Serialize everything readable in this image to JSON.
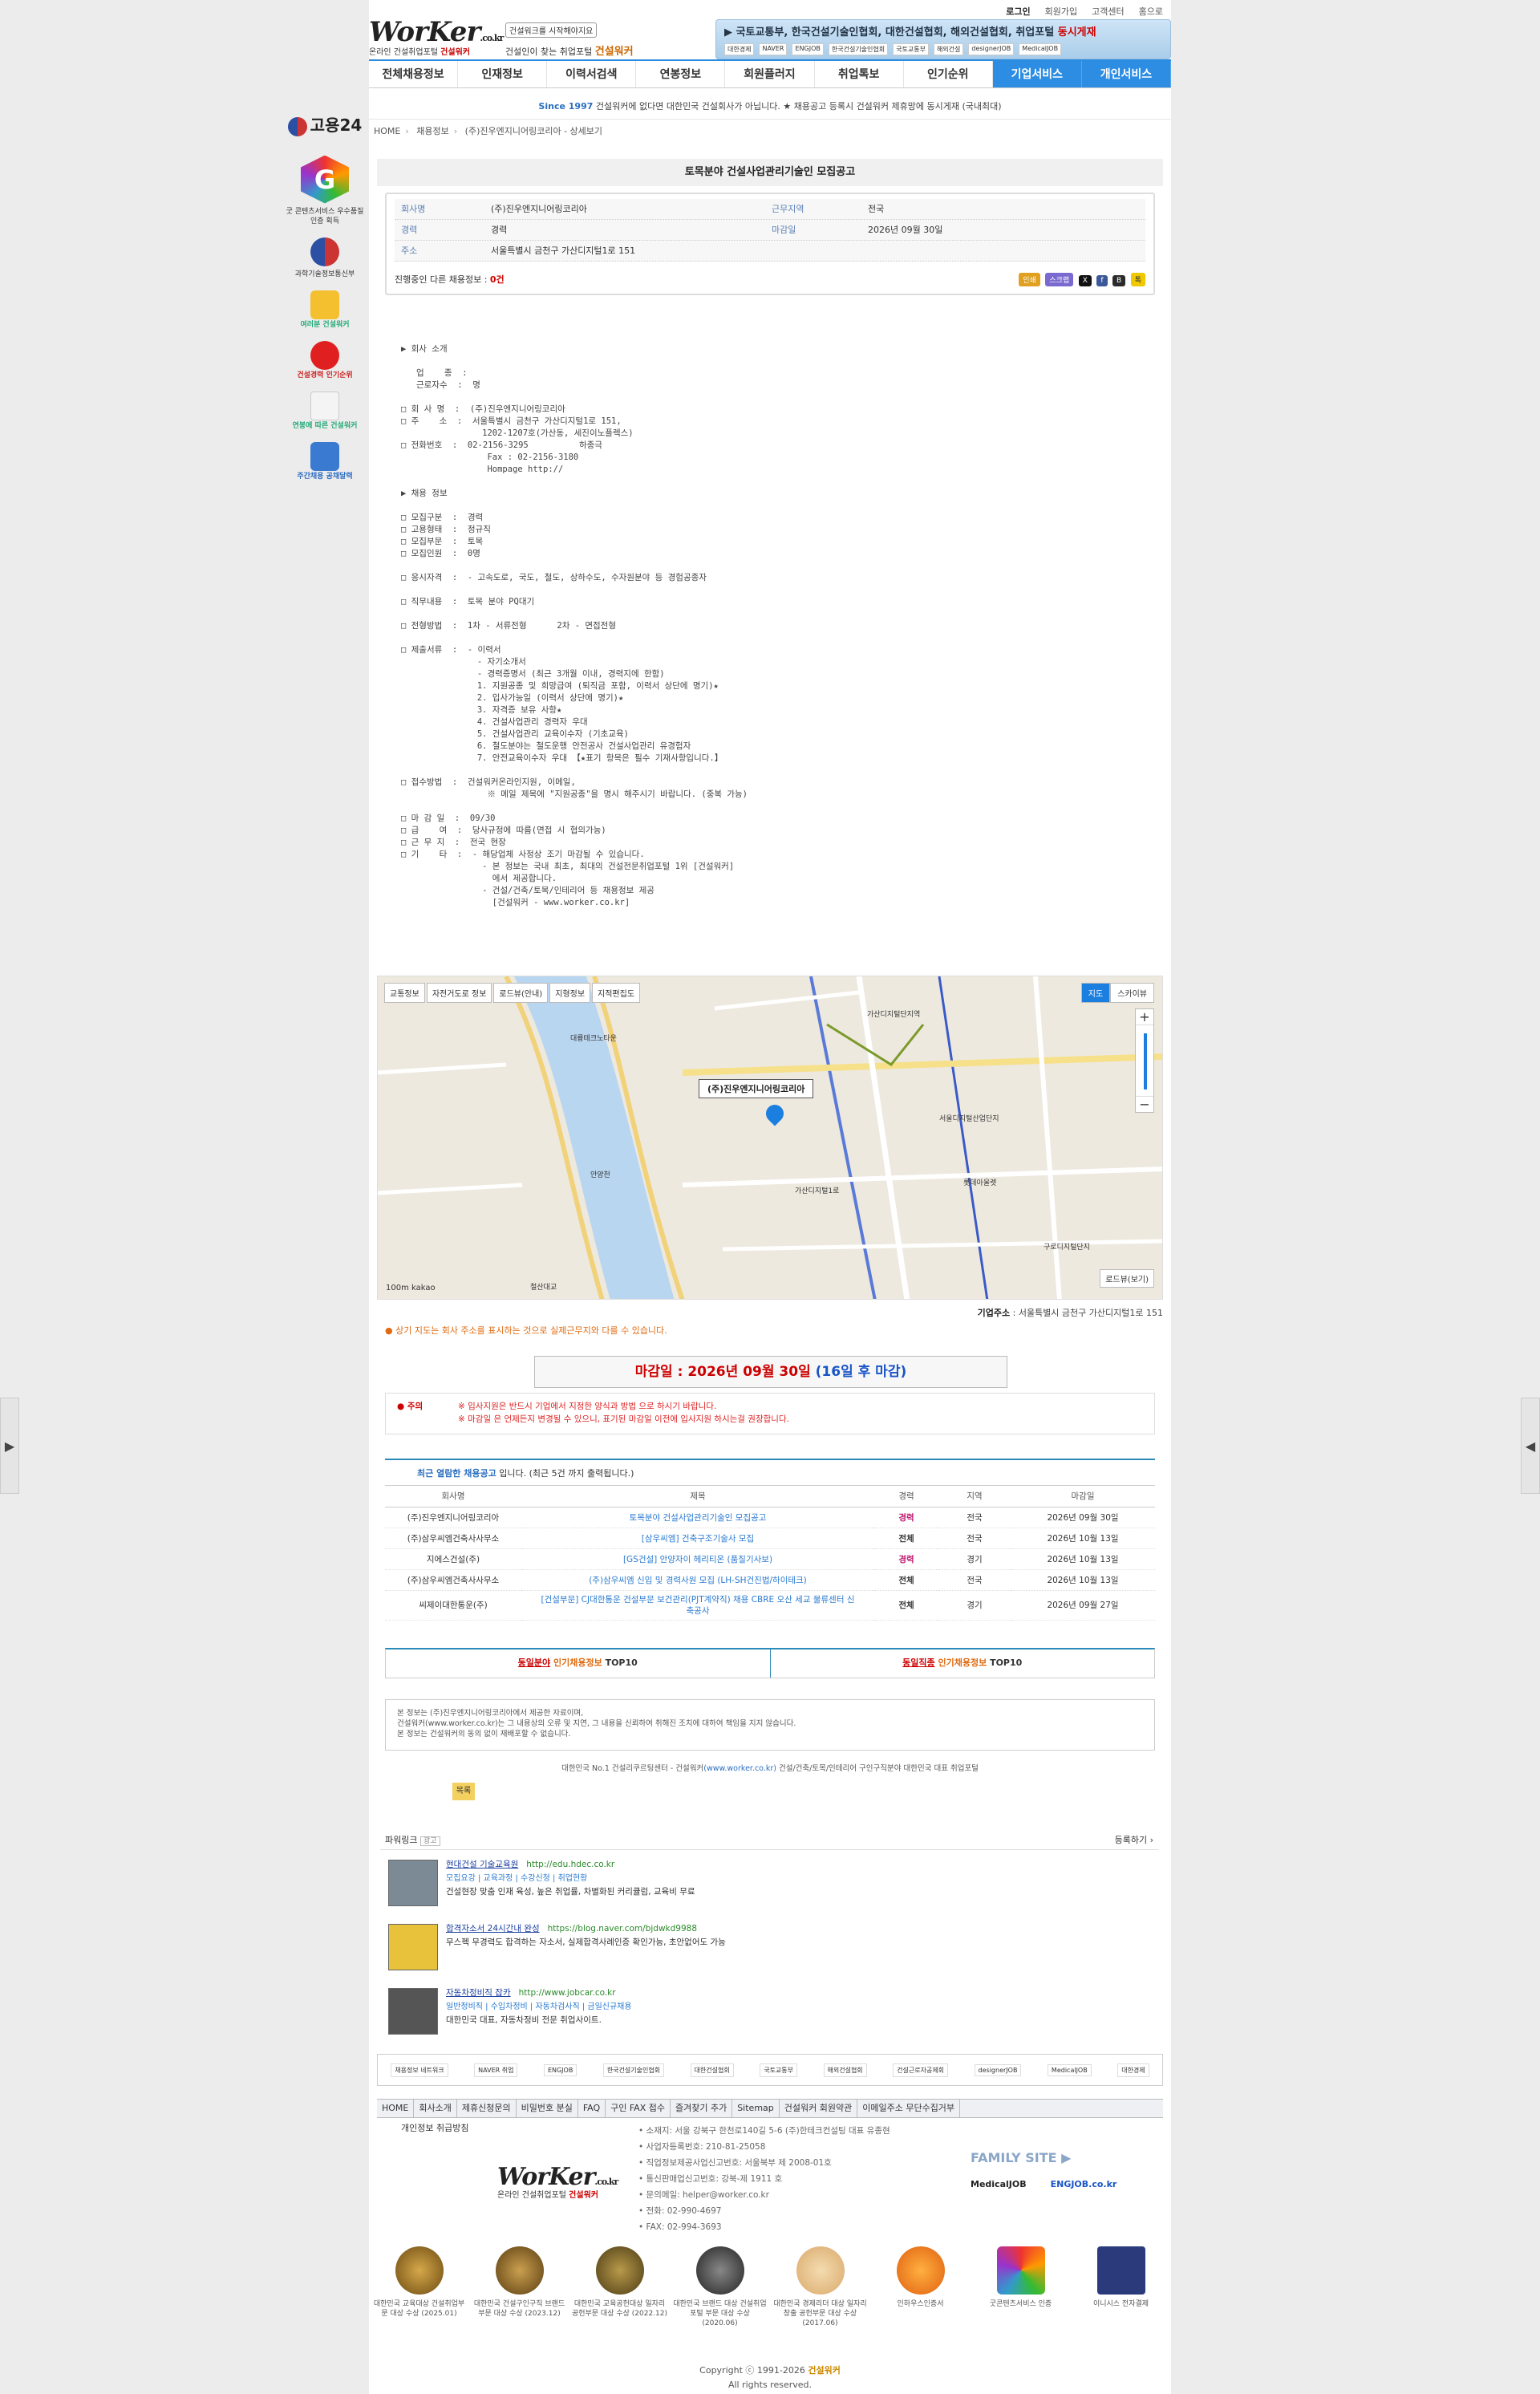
{
  "util": {
    "login": "로그인",
    "join": "회원가입",
    "cs": "고객센터",
    "home": "홈으로"
  },
  "logo": {
    "main": "WorKer",
    "tld": ".co.kr",
    "tagline_prefix": "온라인 건설취업포털",
    "tagline_brand": "건설워커"
  },
  "promo": {
    "pill": "건설워크를 시작해야지요",
    "line_prefix": "건설인이 찾는 취업포털",
    "line_brand": "건설워커"
  },
  "banner": {
    "text": "국토교통부, 한국건설기술인협회, 대한건설협회, 해외건설협회, 취업포털",
    "em": "동시게재",
    "logos": [
      "대한경제",
      "NAVER",
      "ENGJOB",
      "한국건설기술인협회",
      "국토교통부",
      "해외건설",
      "designerJOB",
      "MedicalJOB"
    ]
  },
  "nav": [
    "전체채용정보",
    "인재정보",
    "이력서검색",
    "연봉정보",
    "회원플러지",
    "취업톡보",
    "인기순위",
    "기업서비스",
    "개인서비스"
  ],
  "notice": {
    "since": "Since 1997",
    "text": "건설워커에 없다면 대한민국 건설회사가 아닙니다. ★ 채용공고 등록시 건설워커 제휴망에 동시게재 (국내최대)"
  },
  "side": {
    "goyong": "고용24",
    "cert": "굿 콘텐츠서비스 우수품질인증 획득",
    "ministry": "과학기술정보통신부",
    "items": [
      "여러분 건설워커",
      "건설경력 인기순위",
      "연봉에 따른 건설워커",
      "주간채용 공채달력"
    ]
  },
  "breadcrumb": [
    "HOME",
    "채용정보",
    "(주)진우엔지니어링코리아 - 상세보기"
  ],
  "job": {
    "title": "토목분야 건설사업관리기술인 모집공고",
    "rows": [
      {
        "k": "회사명",
        "v": "(주)진우엔지니어링코리아",
        "k2": "근무지역",
        "v2": "전국"
      },
      {
        "k": "경력",
        "v": "경력",
        "k2": "마감일",
        "v2": "2026년 09월 30일"
      },
      {
        "k": "주소",
        "v": "서울특별시 금천구 가산디지털1로 151",
        "k2": "",
        "v2": ""
      }
    ],
    "ongoing_label": "진행중인 다른 채용정보 :",
    "ongoing_count": "0건",
    "btns": [
      "인쇄",
      "스크랩",
      "X",
      "f",
      "B",
      "톡"
    ]
  },
  "content": "▶ 회사 소개\n\n   업    종  :\n   근로자수  :  명\n\n□ 회 사 명  :  (주)진우엔지니어링코리아\n□ 주    소  :  서울특별시 금천구 가산디지털1로 151,\n                1202-1207호(가산동, 세진이노플렉스)\n□ 전화번호  :  02-2156-3295          하종극\n                 Fax : 02-2156-3180\n                 Hompage http://\n\n▶ 채용 정보\n\n□ 모집구분  :  경력\n□ 고용형태  :  정규직\n□ 모집부문  :  토목\n□ 모집인원  :  0명\n\n□ 응시자격  :  - 고속도로, 국도, 철도, 상하수도, 수자원분야 등 경험공종자\n\n□ 직무내용  :  토목 분야 PQ대기\n\n□ 전형방법  :  1차 - 서류전형      2차 - 면접전형\n\n□ 제출서류  :  - 이력서\n               - 자기소개서\n               - 경력증명서 (최근 3개월 이내, 경력지에 한함)\n               1. 지원공종 및 희망급여 (퇴직금 포함, 이력서 상단에 명기)★\n               2. 입사가능일 (이력서 상단에 명기)★\n               3. 자격증 보유 사항★\n               4. 건설사업관리 경력자 우대\n               5. 건설사업관리 교육이수자 (기초교육)\n               6. 철도분야는 철도운행 안전공사 건설사업관리 유경험자\n               7. 안전교육이수자 우대 【★표기 항목은 필수 기재사항입니다.】\n\n□ 접수방법  :  건설워커온라인지원, 이메일,\n                 ※ 메일 제목에 \"지원공종\"을 명시 해주시기 바랍니다. (중복 가능)\n\n□ 마 감 일  :  09/30\n□ 급    여  :  당사규정에 따름(면접 시 협의가능)\n□ 근 무 지  :  전국 현장\n□ 기    타  :  - 해당업체 사정상 조기 마감될 수 있습니다.\n                - 본 정보는 국내 최초, 최대의 건설전문취업포털 1위 [건설워커]\n                  에서 제공합니다.\n                - 건설/건축/토목/인테리어 등 채용정보 제공\n                  [건설워커 - www.worker.co.kr]",
  "map": {
    "toolbar": [
      "교통정보",
      "자전거도로 정보",
      "로드뷰(안내)",
      "지형정보",
      "지적편집도"
    ],
    "types": [
      "지도",
      "스카이뷰"
    ],
    "label": "(주)진우엔지니어링코리아",
    "roadview": "로드뷰(보기)",
    "scale": "100m  kakao",
    "pois": [
      "가산디지털단지역",
      "서울디지털산업단지",
      "롯데아울렛",
      "대륭테크노타운",
      "가산디지털1로",
      "안양천",
      "철산대교",
      "구로디지털단지"
    ]
  },
  "addr": {
    "label": "기업주소",
    "value": "서울특별시 금천구 가산디지털1로 151"
  },
  "mapnote": "상기 지도는 회사 주소를 표시하는 것으로 실제근무지와 다를 수 있습니다.",
  "deadline": {
    "prefix": "마감일 : 2026년 09월 30일",
    "remain": "(16일 후 마감)"
  },
  "warn": {
    "title": "주의",
    "l1": "※ 입사지원은 반드시 기업에서 지정한 양식과 방법 으로 하시기 바랍니다.",
    "l2": "※ 마감일 은 언제든지 변경될 수 있으니, 표기된 마감일 이전에 입사지원 하시는걸 권장합니다."
  },
  "recent": {
    "hd_em": "최근 열람한 채용공고",
    "hd_text": "입니다.   (최근 5건 까지 출력됩니다.)",
    "cols": [
      "회사명",
      "제목",
      "경력",
      "지역",
      "마감일"
    ],
    "rows": [
      [
        "(주)진우엔지니어링코리아",
        "토목분야 건설사업관리기술인 모집공고",
        "경력",
        "전국",
        "2026년 09월 30일"
      ],
      [
        "(주)삼우씨엠건축사사무소",
        "[삼우씨엠] 건축구조기술사 모집",
        "전체",
        "전국",
        "2026년 10월 13일"
      ],
      [
        "지에스건설(주)",
        "[GS건설] 안양자이 헤리티온 (품질기사보)",
        "경력",
        "경기",
        "2026년 10월 13일"
      ],
      [
        "(주)삼우씨엠건축사사무소",
        "(주)삼우씨엠 신입 및 경력사원 모집 (LH-SH건진법/하이테크)",
        "전체",
        "전국",
        "2026년 10월 13일"
      ],
      [
        "씨제이대한통운(주)",
        "[건설부문] CJ대한통운 건설부문 보건관리(PJT계약직) 채용 CBRE 오산 세교 물류센터 신축공사",
        "전체",
        "경기",
        "2026년 09월 27일"
      ]
    ]
  },
  "tops": {
    "left_u": "동일분야",
    "left_em": "인기채용정보",
    "left_t": "TOP10",
    "right_u": "동일직종",
    "right_em": "인기채용정보",
    "right_t": "TOP10"
  },
  "disclaimer": [
    "본 정보는 (주)진우엔지니어링코리아에서 제공한 자료이며,",
    "건설워커(www.worker.co.kr)는 그 내용상의 오류 및 지연, 그 내용을 신뢰하여 취해진 조치에 대하여 책임을 지지 않습니다.",
    "본 정보는 건설워커의 동의 없이 재배포할 수 없습니다."
  ],
  "copyline": {
    "prefix": "대한민국 No.1 건설리쿠르팅센터 - 건설워커",
    "url": "(www.worker.co.kr)",
    "suffix": "건설/건축/토목/인테리어 구인구직분야 대한민국 대표 취업포털"
  },
  "smallbtn": "목록",
  "power": {
    "title": "파워링크",
    "ad": "광고",
    "register": "등록하기 ›",
    "items": [
      {
        "name": "현대건설 기술교육원",
        "url": "http://edu.hdec.co.kr",
        "sub": "모집요강 | 교육과정 | 수강신청 | 취업현황",
        "desc": "건설현장 맞춤 인재 육성, 높은 취업률, 차별화된 커리큘럼, 교육비 무료"
      },
      {
        "name": "합격자소서 24시간내 완성",
        "url": "https://blog.naver.com/bjdwkd9988",
        "sub": "",
        "desc": "무스펙 무경력도 합격하는 자소서, 실제합격사례인증 확인가능, 초안없어도 가능"
      },
      {
        "name": "자동차정비직 잡카",
        "url": "http://www.jobcar.co.kr",
        "sub": "일반정비직 | 수입차정비 | 자동차검사직 | 금일신규채용",
        "desc": "대한민국 대표, 자동차정비 전문 취업사이트."
      }
    ]
  },
  "partners": [
    "채용정보 네트워크",
    "NAVER 취업",
    "ENGJOB",
    "한국건설기술인협회",
    "대한건설협회",
    "국토교통부",
    "해외건설협회",
    "건설근로자공제회",
    "designerJOB",
    "MedicalJOB",
    "대한경제"
  ],
  "fnav": [
    "HOME",
    "회사소개",
    "제휴신청문의",
    "비밀번호 분실",
    "FAQ",
    "구인 FAX 접수",
    "즐겨찾기 추가",
    "Sitemap",
    "건설워커 회원약관",
    "이메일주소 무단수집거부"
  ],
  "privacy": "개인정보 취급방침",
  "finfo": [
    "소재지: 서울 강북구 한천로140길 5-6 (주)한테크컨설팅 대표 유종현",
    "사업자등록번호: 210-81-25058",
    "직업정보제공사업신고번호: 서울북부 제 2008-01호",
    "통신판매업신고번호: 강북-제 1911 호",
    "문의메일: helper@worker.co.kr",
    "전화: 02-990-4697",
    "FAX: 02-994-3693"
  ],
  "family": "FAMILY SITE ▶",
  "family_sites": [
    "MedicalJOB",
    "ENGJOB.co.kr"
  ],
  "awards": [
    {
      "t": "대한민국 교육대상 건설취업부문 대상 수상 (2025.01)",
      "c": "#6b4a12"
    },
    {
      "t": "대한민국 건설구인구직 브랜드부문 대상 수상 (2023.12)",
      "c": "#5a3c10"
    },
    {
      "t": "대한민국 교육공헌대상 일자리 공헌부문 대상 수상 (2022.12)",
      "c": "#4b3a15"
    },
    {
      "t": "대한민국 브랜드 대상 건설취업포털 부문 대상 수상 (2020.06)",
      "c": "#333333"
    },
    {
      "t": "대한민국 경제리더 대상 일자리창출 공헌부문 대상 수상 (2017.06)",
      "c": "#d9a86a"
    },
    {
      "t": "인하우스인증서",
      "c": "#e88a1a"
    },
    {
      "t": "굿콘텐츠서비스 인증",
      "c": "#c24a8a"
    },
    {
      "t": "이니시스 전자결제",
      "c": "#2a3a7a"
    }
  ],
  "copy": {
    "line1_prefix": "Copyright ⓒ 1991-2026",
    "brand": "건설워커",
    "line2": "All rights reserved."
  }
}
